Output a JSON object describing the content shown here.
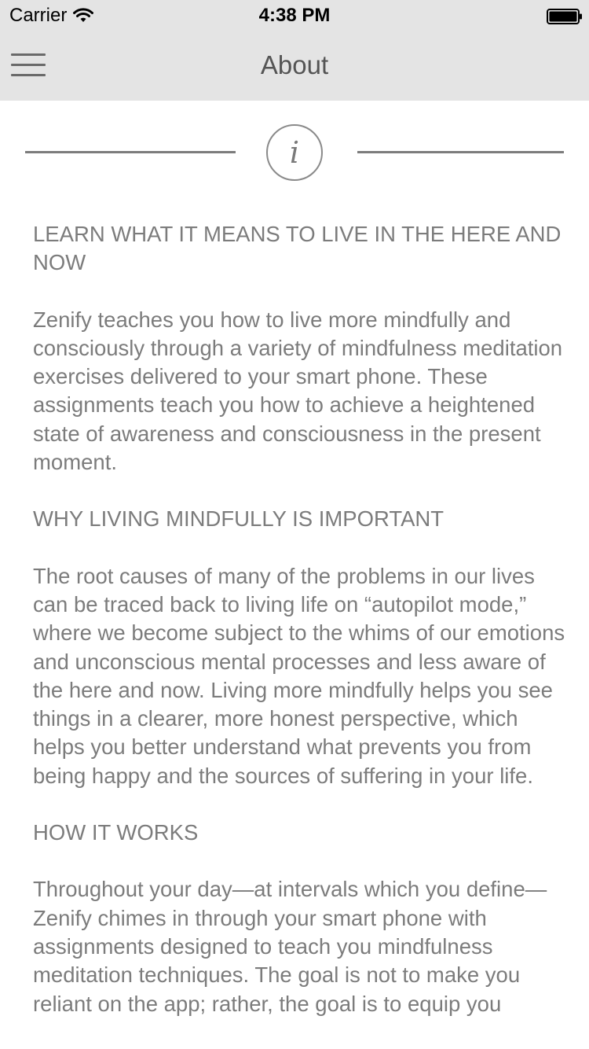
{
  "status_bar": {
    "carrier": "Carrier",
    "time": "4:38 PM",
    "wifi_icon": "wifi-icon",
    "battery_icon": "battery-icon"
  },
  "nav": {
    "title": "About",
    "menu_icon": "hamburger-menu-icon"
  },
  "header_icon": {
    "name": "info-icon",
    "glyph": "i"
  },
  "sections": [
    {
      "heading": "LEARN WHAT IT MEANS TO LIVE IN THE HERE AND NOW",
      "body": "Zenify teaches you how to live more mindfully and consciously through a variety of mindfulness meditation exercises delivered to your smart phone. These assignments teach you how to achieve a heightened state of awareness and consciousness in the present moment."
    },
    {
      "heading": "WHY LIVING MINDFULLY IS IMPORTANT",
      "body": "The root causes of many of the problems in our lives can be traced back to living life on “autopilot mode,” where we become subject to the whims of our emotions and unconscious mental processes and less aware of the here and now. Living more mindfully helps you see things in a clearer, more honest perspective, which helps you better understand what prevents you from being happy and the sources of suffering in your life."
    },
    {
      "heading": "HOW IT WORKS",
      "body": "Throughout your day—at intervals which you define—Zenify chimes in through your smart phone with assignments designed to teach you mindfulness meditation techniques. The goal is not to make you reliant on the app; rather, the goal is to equip you"
    }
  ]
}
